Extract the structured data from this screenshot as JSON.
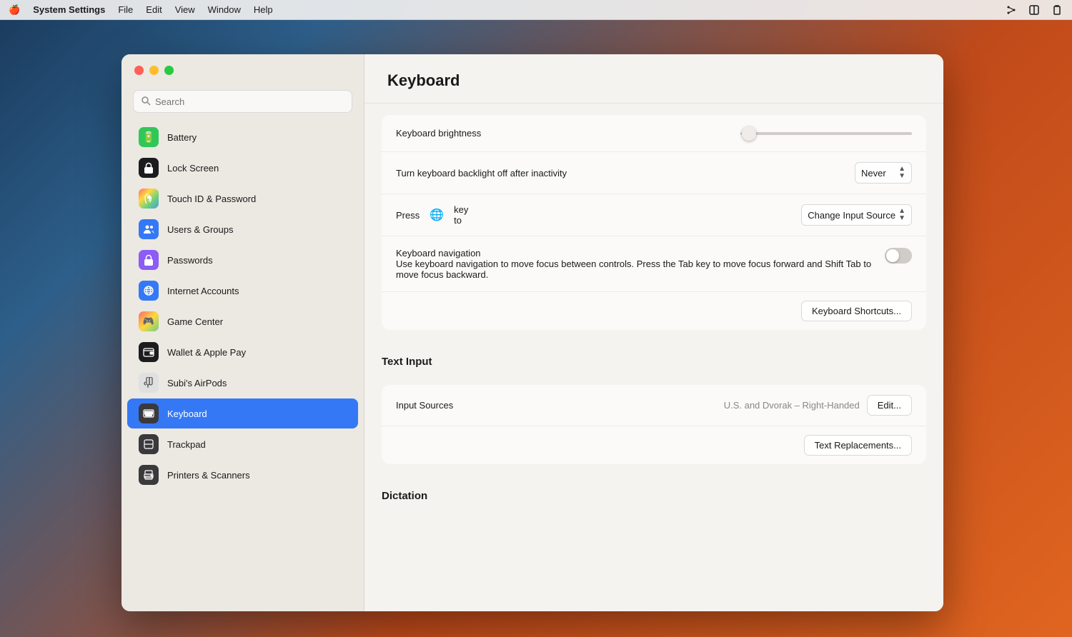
{
  "menubar": {
    "apple": "🍎",
    "appName": "System Settings",
    "menus": [
      "File",
      "Edit",
      "View",
      "Window",
      "Help"
    ],
    "rightIcons": [
      "share-icon",
      "switch-icon",
      "clipboard-icon"
    ]
  },
  "window": {
    "title": "Keyboard"
  },
  "sidebar": {
    "searchPlaceholder": "Search",
    "items": [
      {
        "id": "battery",
        "label": "Battery",
        "icon": "🔋",
        "iconClass": "icon-battery"
      },
      {
        "id": "lockscreen",
        "label": "Lock Screen",
        "icon": "🔒",
        "iconClass": "icon-lock"
      },
      {
        "id": "touchid",
        "label": "Touch ID & Password",
        "icon": "👆",
        "iconClass": "icon-touchid"
      },
      {
        "id": "users",
        "label": "Users & Groups",
        "icon": "👥",
        "iconClass": "icon-users"
      },
      {
        "id": "passwords",
        "label": "Passwords",
        "icon": "🔑",
        "iconClass": "icon-passwords"
      },
      {
        "id": "internet",
        "label": "Internet Accounts",
        "icon": "@",
        "iconClass": "icon-internet"
      },
      {
        "id": "gamecenter",
        "label": "Game Center",
        "icon": "🎮",
        "iconClass": "icon-gamecenter"
      },
      {
        "id": "wallet",
        "label": "Wallet & Apple Pay",
        "icon": "💳",
        "iconClass": "icon-wallet"
      },
      {
        "id": "airpods",
        "label": "Subi's AirPods",
        "icon": "🎧",
        "iconClass": "icon-airpods"
      },
      {
        "id": "keyboard",
        "label": "Keyboard",
        "icon": "⌨️",
        "iconClass": "icon-keyboard",
        "active": true
      },
      {
        "id": "trackpad",
        "label": "Trackpad",
        "icon": "⬛",
        "iconClass": "icon-trackpad"
      },
      {
        "id": "printers",
        "label": "Printers & Scanners",
        "icon": "🖨️",
        "iconClass": "icon-printer"
      }
    ]
  },
  "main": {
    "pageTitle": "Keyboard",
    "settings": {
      "keyboardBrightness": {
        "label": "Keyboard brightness",
        "sliderValue": 5
      },
      "backlightOff": {
        "label": "Turn keyboard backlight off after inactivity",
        "value": "Never"
      },
      "pressKeyTo": {
        "label": "Press",
        "keyLabel": "🌐",
        "labelSuffix": "key to",
        "value": "Change Input Source"
      },
      "keyboardNavigation": {
        "label": "Keyboard navigation",
        "subLabel": "Use keyboard navigation to move focus between controls. Press the Tab key to move focus forward and Shift Tab to move focus backward.",
        "enabled": false
      },
      "keyboardShortcutsButton": "Keyboard Shortcuts..."
    },
    "textInput": {
      "sectionTitle": "Text Input",
      "inputSources": {
        "label": "Input Sources",
        "value": "U.S. and Dvorak – Right-Handed",
        "editButton": "Edit..."
      },
      "textReplacementsButton": "Text Replacements..."
    },
    "dictation": {
      "sectionTitle": "Dictation"
    }
  }
}
